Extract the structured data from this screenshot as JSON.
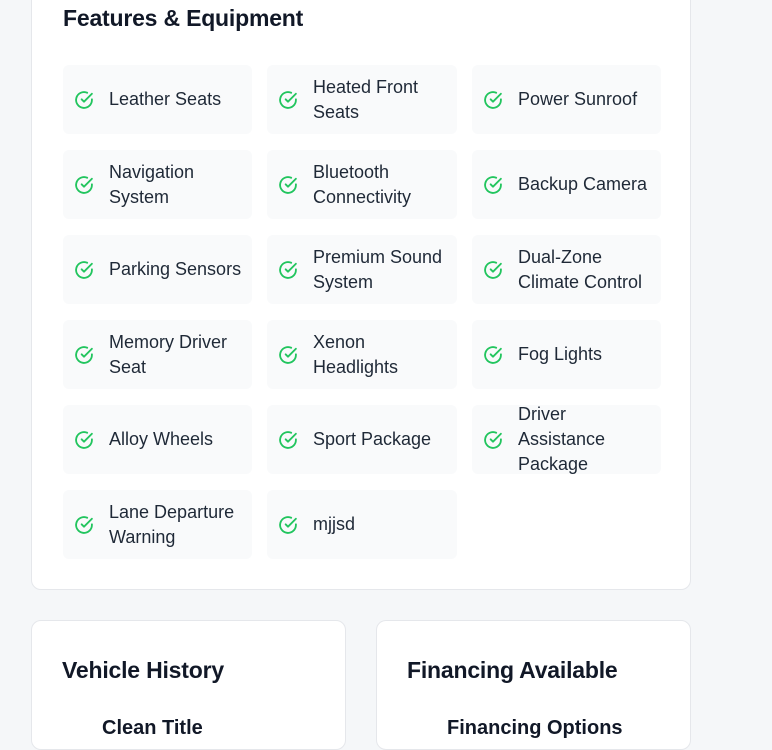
{
  "features": {
    "title": "Features & Equipment",
    "check_color": "#22c55e",
    "items": [
      {
        "label": "Leather Seats"
      },
      {
        "label": "Heated Front Seats"
      },
      {
        "label": "Power Sunroof"
      },
      {
        "label": "Navigation System"
      },
      {
        "label": "Bluetooth Connectivity"
      },
      {
        "label": "Backup Camera"
      },
      {
        "label": "Parking Sensors"
      },
      {
        "label": "Premium Sound System"
      },
      {
        "label": "Dual-Zone Climate Control"
      },
      {
        "label": "Memory Driver Seat"
      },
      {
        "label": "Xenon Headlights"
      },
      {
        "label": "Fog Lights"
      },
      {
        "label": "Alloy Wheels"
      },
      {
        "label": "Sport Package"
      },
      {
        "label": "Driver Assistance Package"
      },
      {
        "label": "Lane Departure Warning"
      },
      {
        "label": "mjjsd"
      }
    ]
  },
  "vehicle_history": {
    "title": "Vehicle History",
    "first_item": "Clean Title"
  },
  "financing": {
    "title": "Financing Available",
    "first_item": "Financing Options"
  }
}
